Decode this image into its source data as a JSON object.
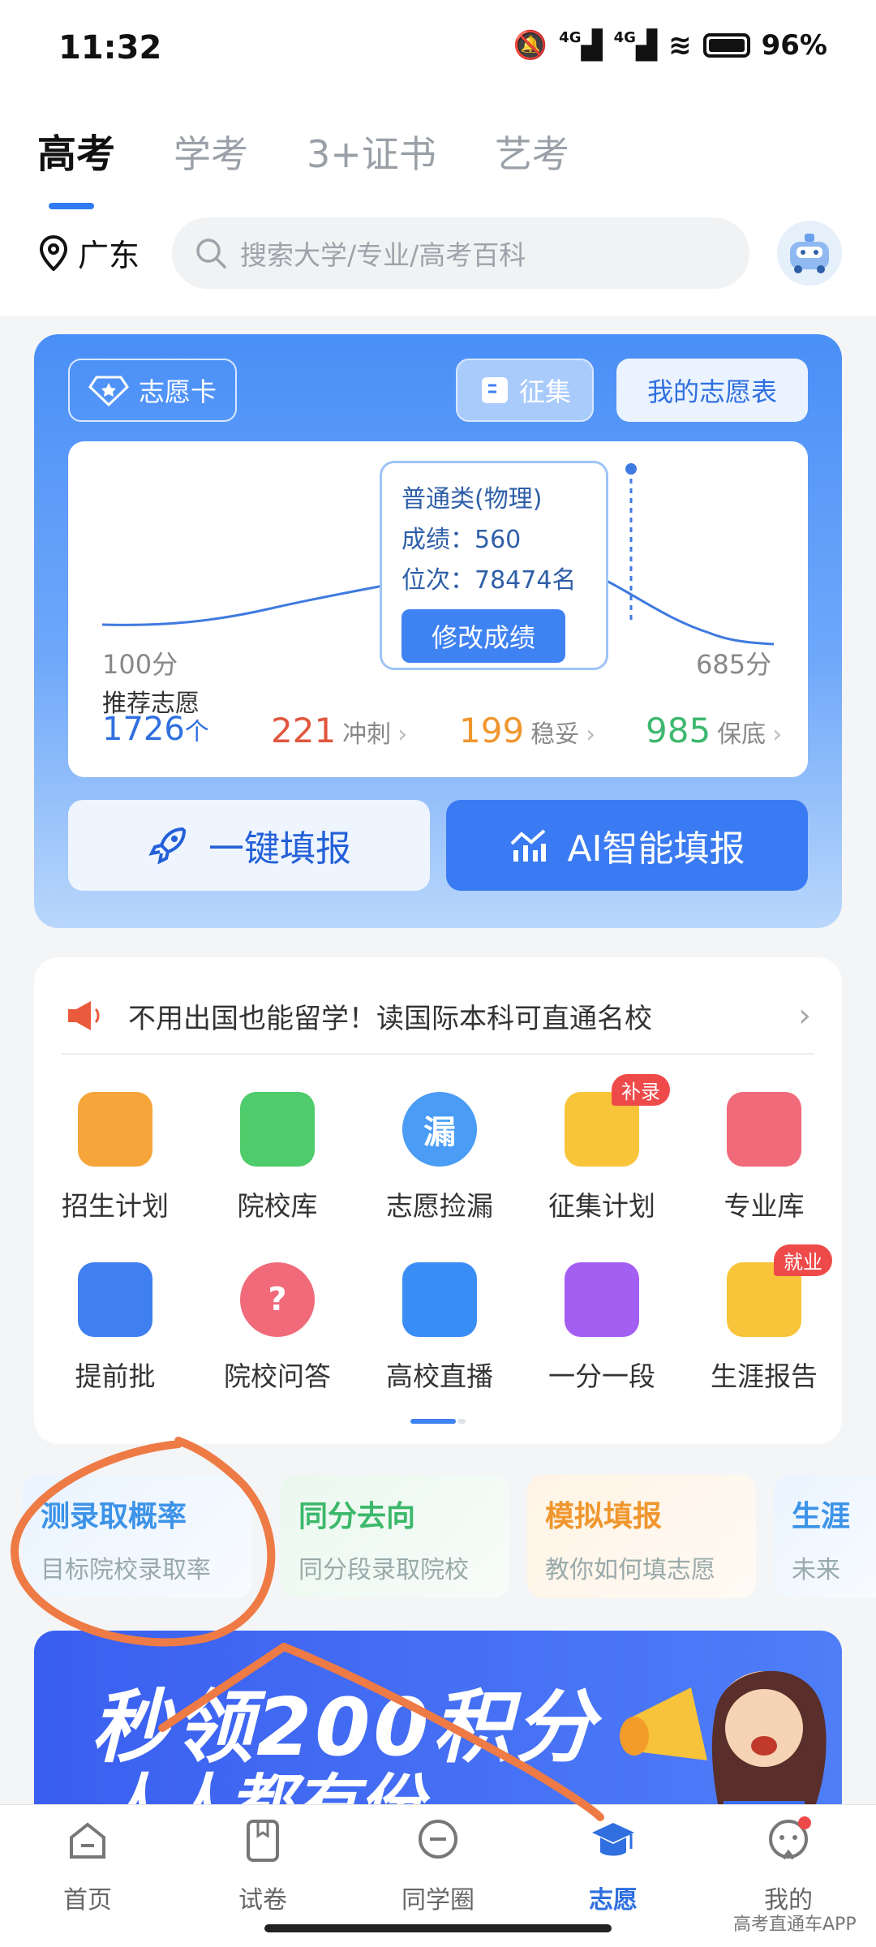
{
  "status": {
    "time": "11:32",
    "signal1": "4G",
    "signal2": "4G",
    "battery": "96%"
  },
  "tabs": [
    "高考",
    "学考",
    "3+证书",
    "艺考"
  ],
  "location": "广东",
  "search": {
    "placeholder": "搜索大学/专业/高考百科"
  },
  "card": {
    "zhiyuanka": "志愿卡",
    "zhengji": "征集",
    "my_table": "我的志愿表",
    "tooltip": {
      "line1": "普通类(物理)",
      "line2": "成绩：560",
      "line3": "位次：78474名",
      "button": "修改成绩"
    },
    "axis_min": "100分",
    "axis_max": "685分",
    "rec_title": "推荐志愿",
    "rec_count": "1726",
    "rec_unit": "个",
    "stats": [
      {
        "n": "221",
        "l": "冲刺",
        "color": "#e0573e"
      },
      {
        "n": "199",
        "l": "稳妥",
        "color": "#f0962e"
      },
      {
        "n": "985",
        "l": "保底",
        "color": "#3db86f"
      }
    ],
    "btn_one_click": "一键填报",
    "btn_ai": "AI智能填报"
  },
  "notice": "不用出国也能留学！读国际本科可直通名校",
  "grid": [
    {
      "label": "招生计划",
      "icon": "enrollment-plan-icon",
      "color": "#f6a53a"
    },
    {
      "label": "院校库",
      "icon": "school-library-icon",
      "color": "#4ecb6a"
    },
    {
      "label": "志愿捡漏",
      "icon": "volunteer-pickup-icon",
      "color": "#4a9cf5",
      "glyph": "漏"
    },
    {
      "label": "征集计划",
      "icon": "collection-plan-icon",
      "color": "#f8c53a",
      "badge": "补录"
    },
    {
      "label": "专业库",
      "icon": "major-library-icon",
      "color": "#f06a7a"
    },
    {
      "label": "提前批",
      "icon": "early-batch-icon",
      "color": "#3f7ff0"
    },
    {
      "label": "院校问答",
      "icon": "school-qa-icon",
      "color": "#f06a7a",
      "glyph": "?"
    },
    {
      "label": "高校直播",
      "icon": "live-stream-icon",
      "color": "#3a8df5"
    },
    {
      "label": "一分一段",
      "icon": "score-segment-icon",
      "color": "#a35ef2"
    },
    {
      "label": "生涯报告",
      "icon": "career-report-icon",
      "color": "#f8c53a",
      "badge": "就业"
    }
  ],
  "features": [
    {
      "title": "测录取概率",
      "sub": "目标院校录取率",
      "color": "#3c93e8"
    },
    {
      "title": "同分去向",
      "sub": "同分段录取院校",
      "color": "#3cb86a"
    },
    {
      "title": "模拟填报",
      "sub": "教你如何填志愿",
      "color": "#f0962e"
    },
    {
      "title": "生涯",
      "sub": "未来",
      "color": "#3c93e8"
    }
  ],
  "banner": {
    "line1": "秒领200积分",
    "line2": "人人都有份"
  },
  "nav": [
    "首页",
    "试卷",
    "同学圈",
    "志愿",
    "我的"
  ],
  "watermark": "高考直通车APP"
}
